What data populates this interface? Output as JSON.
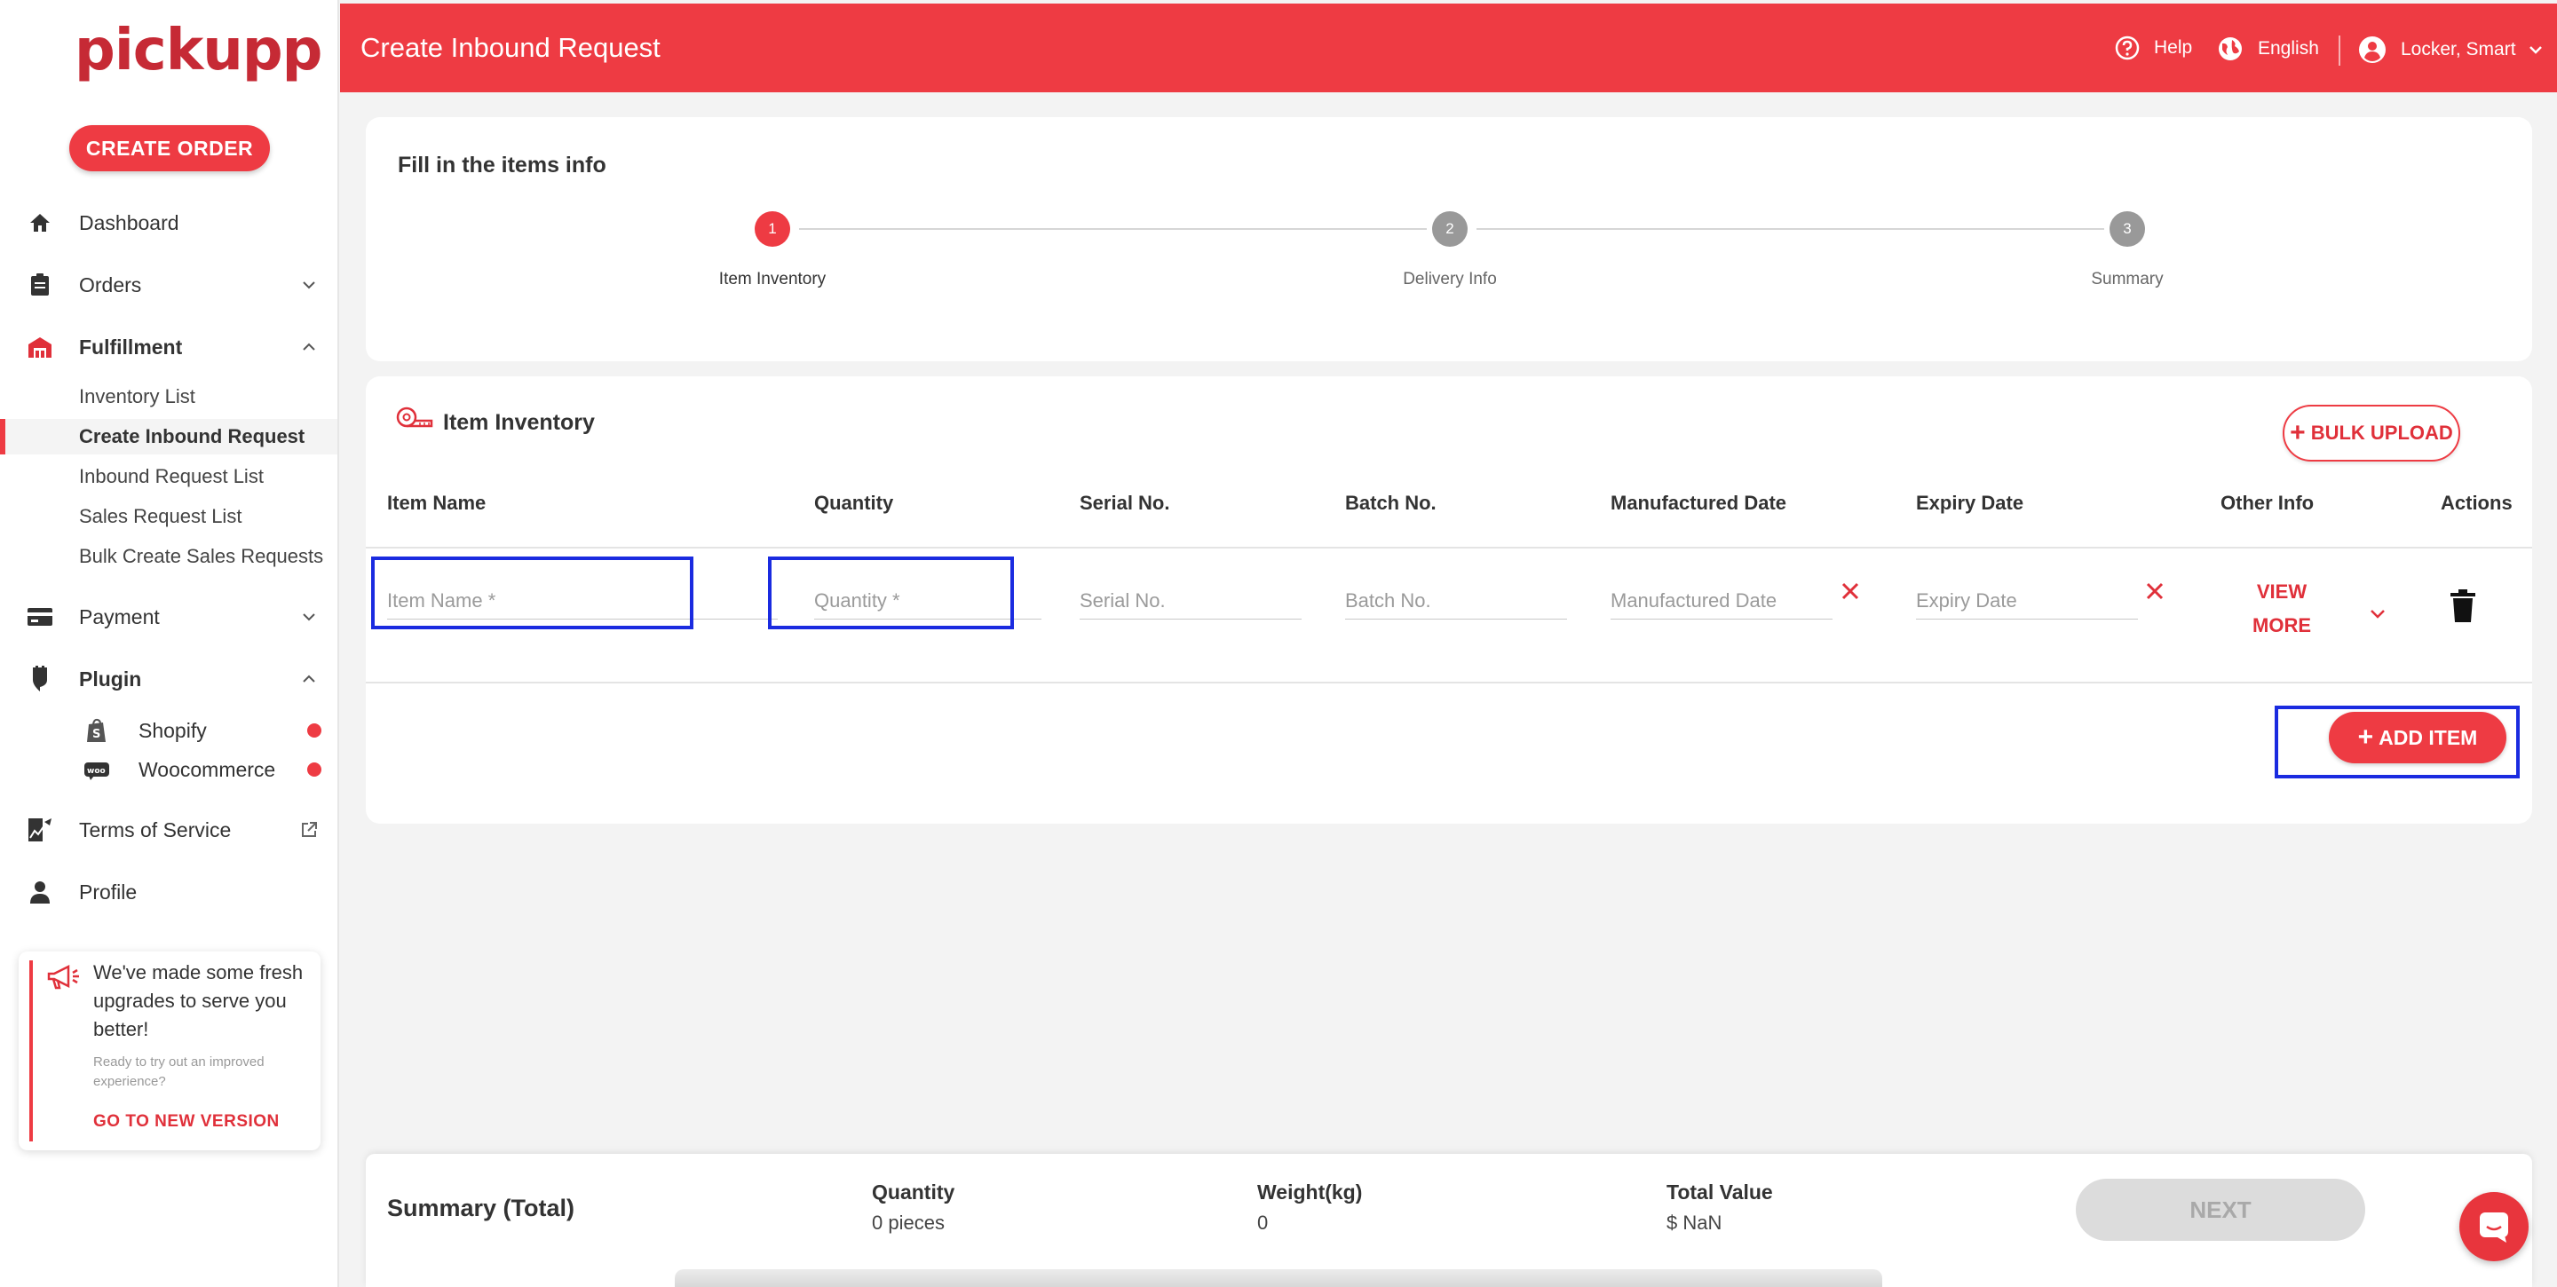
{
  "sidebar": {
    "logo": "pickupp",
    "create_order": "CREATE ORDER",
    "nav": {
      "dashboard": "Dashboard",
      "orders": "Orders",
      "fulfillment": "Fulfillment",
      "payment": "Payment",
      "plugin": "Plugin",
      "terms": "Terms of Service",
      "profile": "Profile"
    },
    "fulfillment_items": [
      "Inventory List",
      "Create Inbound Request",
      "Inbound Request List",
      "Sales Request List",
      "Bulk Create Sales Requests"
    ],
    "plugins": [
      "Shopify",
      "Woocommerce"
    ],
    "promo": {
      "title": "We've made some fresh upgrades to serve you better!",
      "subtitle": "Ready to try out an improved experience?",
      "link": "GO TO NEW VERSION"
    }
  },
  "header": {
    "title": "Create Inbound Request",
    "help": "Help",
    "language": "English",
    "user": "Locker, Smart"
  },
  "stepper": {
    "title": "Fill in the items info",
    "steps": [
      {
        "num": "1",
        "label": "Item Inventory"
      },
      {
        "num": "2",
        "label": "Delivery Info"
      },
      {
        "num": "3",
        "label": "Summary"
      }
    ]
  },
  "inventory": {
    "title": "Item Inventory",
    "bulk_upload": "BULK UPLOAD",
    "columns": [
      "Item Name",
      "Quantity",
      "Serial No.",
      "Batch No.",
      "Manufactured Date",
      "Expiry Date",
      "Other Info",
      "Actions"
    ],
    "placeholders": {
      "item_name": "Item Name *",
      "quantity": "Quantity *",
      "serial": "Serial No.",
      "batch": "Batch No.",
      "manufactured": "Manufactured Date",
      "expiry": "Expiry Date"
    },
    "view_more_1": "VIEW",
    "view_more_2": "MORE",
    "add_item": "ADD ITEM"
  },
  "summary": {
    "title": "Summary (Total)",
    "quantity_label": "Quantity",
    "quantity_value": "0 pieces",
    "weight_label": "Weight(kg)",
    "weight_value": "0",
    "total_label": "Total Value",
    "total_value": "$ NaN",
    "next": "NEXT"
  },
  "colors": {
    "brand": "#ee3b43",
    "highlight": "#1a2be0"
  }
}
